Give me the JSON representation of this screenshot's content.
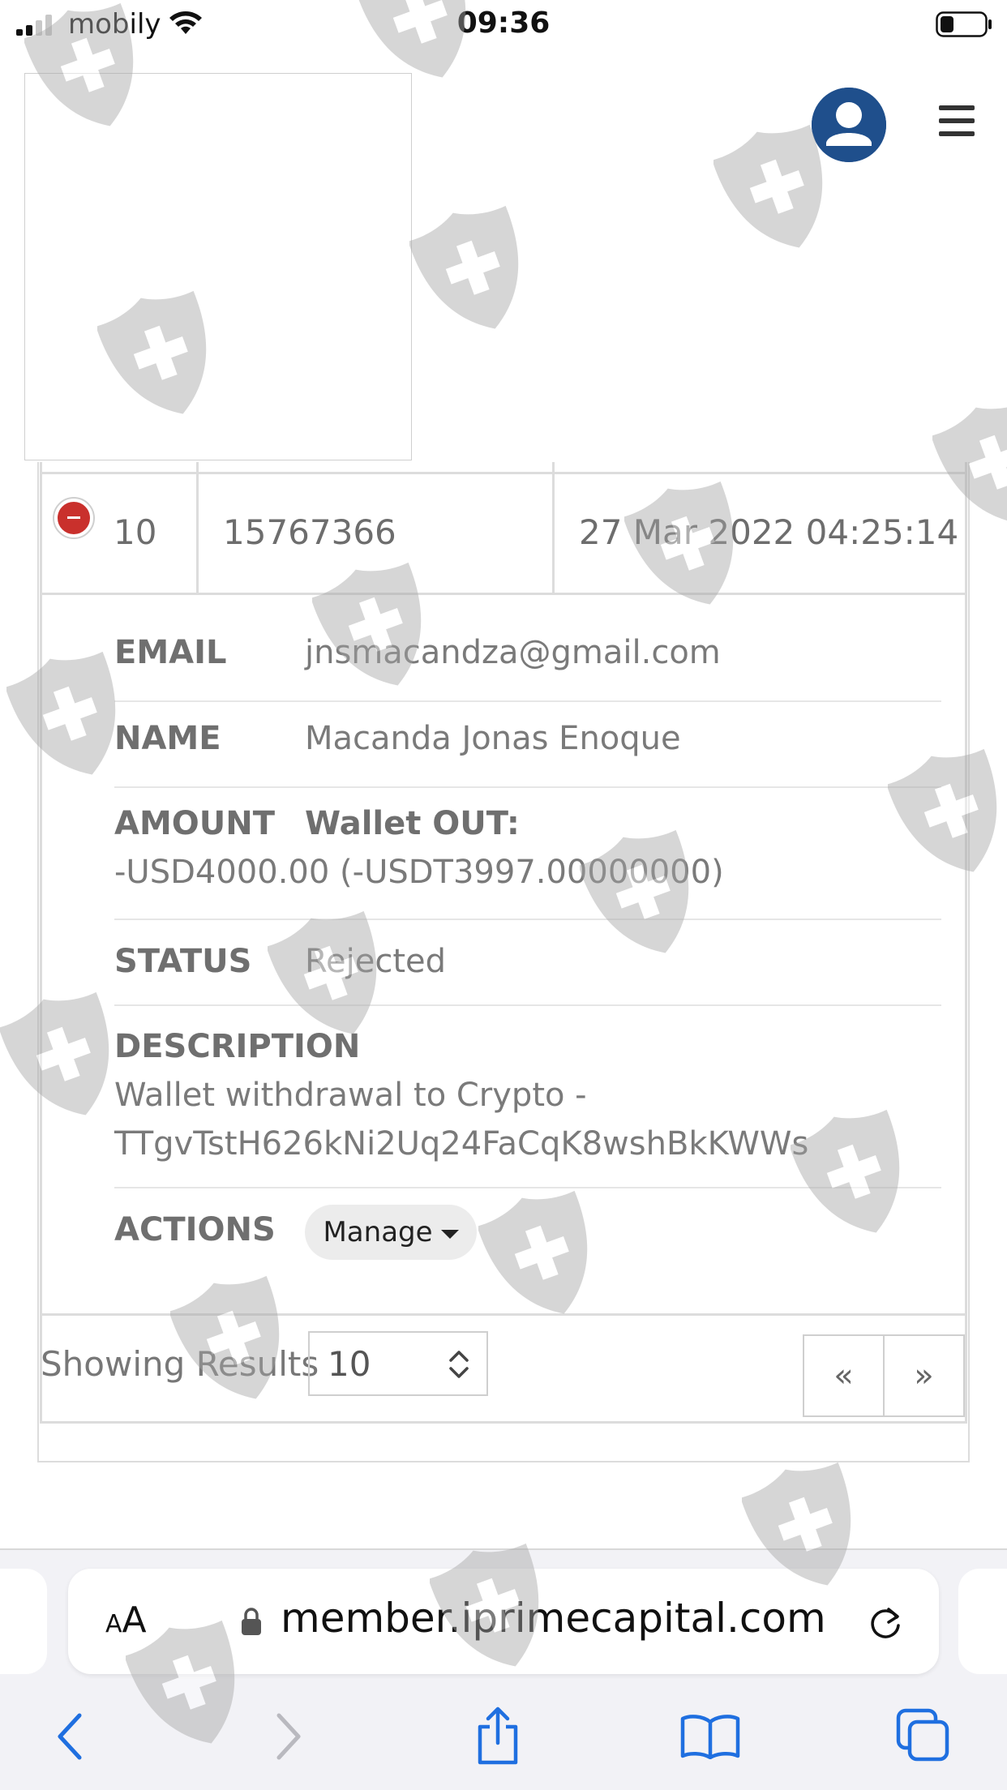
{
  "status_bar": {
    "carrier": "mobily",
    "time": "09:36"
  },
  "table": {
    "row": {
      "index": "10",
      "id": "15767366",
      "datetime": "27 Mar 2022 04:25:14"
    },
    "details": {
      "email_label": "EMAIL",
      "email_value": "jnsmacandza@gmail.com",
      "name_label": "NAME",
      "name_value": "Macanda Jonas Enoque",
      "amount_label": "AMOUNT",
      "amount_type": "Wallet OUT:",
      "amount_value": "-USD4000.00 (-USDT3997.00000000)",
      "status_label": "STATUS",
      "status_value": "Rejected",
      "description_label": "DESCRIPTION",
      "description_line1": "Wallet withdrawal to Crypto -",
      "description_line2": "TTgvTstH626kNi2Uq24FaCqK8wshBkKWWs",
      "actions_label": "ACTIONS",
      "manage_label": "Manage"
    },
    "footer": {
      "showing_label": "Showing Results",
      "page_size": "10",
      "prev_label": "«",
      "next_label": "»"
    }
  },
  "browser": {
    "aa_small": "A",
    "aa_big": "A",
    "url": "member.iprimecapital.com"
  },
  "colors": {
    "accent_blue": "#1f6fe0",
    "avatar_blue": "#1f4f8c",
    "danger_red": "#c9302c",
    "border": "#dcdcdc"
  },
  "icons": [
    "signal-icon",
    "wifi-icon",
    "battery-icon",
    "avatar-icon",
    "hamburger-menu-icon",
    "collapse-row-icon",
    "caret-down-icon",
    "select-arrows-icon",
    "lock-icon",
    "reload-icon",
    "back-icon",
    "forward-icon",
    "share-icon",
    "bookmarks-icon",
    "tabs-icon",
    "shield-watermark-icon"
  ]
}
